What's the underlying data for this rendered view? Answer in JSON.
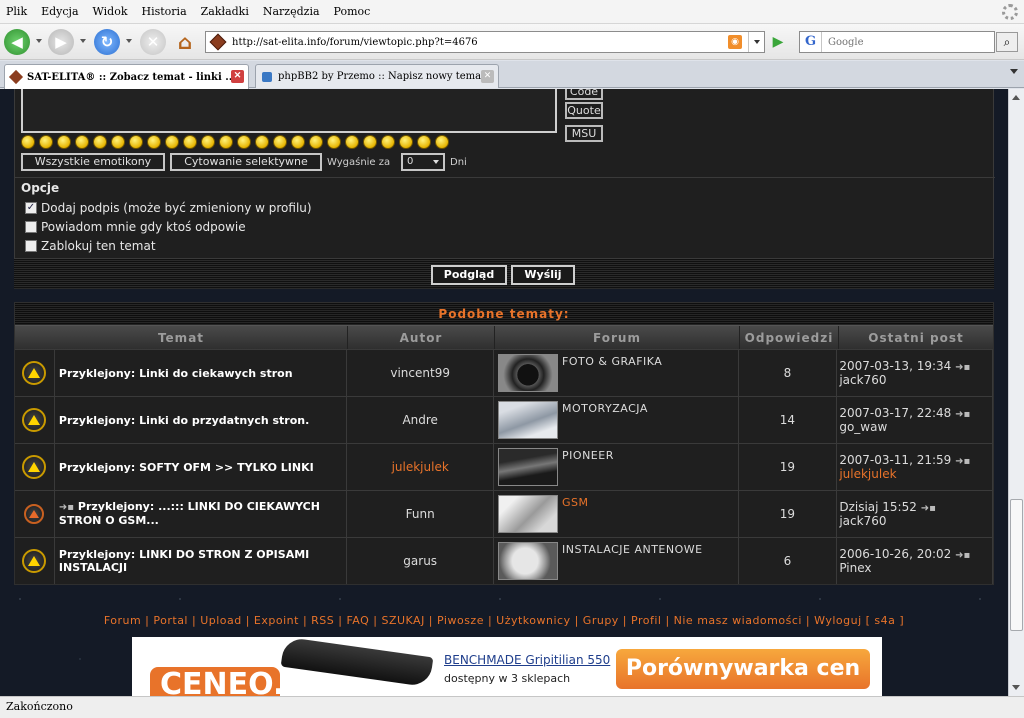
{
  "menu": [
    "Plik",
    "Edycja",
    "Widok",
    "Historia",
    "Zakładki",
    "Narzędzia",
    "Pomoc"
  ],
  "address": {
    "url": "http://sat-elita.info/forum/viewtopic.php?t=4676"
  },
  "search": {
    "engine": "G",
    "placeholder": "Google"
  },
  "tabs": [
    {
      "label": "SAT-ELITA® :: Zobacz temat - linki ..."
    },
    {
      "label": "phpBB2 by Przemo :: Napisz nowy temat"
    }
  ],
  "editor": {
    "side_buttons": [
      "Code",
      "Quote",
      "MSU"
    ],
    "btn_emoticons": "Wszystkie emotikony",
    "btn_quote": "Cytowanie selektywne",
    "expire_label": "Wygaśnie za",
    "expire_value": "0",
    "days": "Dni"
  },
  "options": {
    "title": "Opcje",
    "items": [
      {
        "label": "Dodaj podpis (może być zmieniony w profilu)",
        "checked": true
      },
      {
        "label": "Powiadom mnie gdy ktoś odpowie",
        "checked": false
      },
      {
        "label": "Zablokuj ten temat",
        "checked": false
      }
    ]
  },
  "actions": {
    "preview": "Podgląd",
    "send": "Wyślij"
  },
  "similar": {
    "title": "Podobne tematy:",
    "headers": [
      "Temat",
      "Autor",
      "Forum",
      "Odpowiedzi",
      "Ostatni post"
    ],
    "rows": [
      {
        "prefix": "Przyklejony:",
        "topic": "Linki do ciekawych stron",
        "author": "vincent99",
        "forum": "FOTO & GRAFIKA",
        "replies": "8",
        "last_date": "2007-03-13, 19:34",
        "last_user": "jack760"
      },
      {
        "prefix": "Przyklejony:",
        "topic": "Linki do przydatnych stron.",
        "author": "Andre",
        "forum": "MOTORYZACJA",
        "replies": "14",
        "last_date": "2007-03-17, 22:48",
        "last_user": "go_waw"
      },
      {
        "prefix": "Przyklejony:",
        "topic": "SOFTY OFM >> TYLKO LINKI",
        "author": "julekjulek",
        "forum": "PIONEER",
        "replies": "19",
        "last_date": "2007-03-11, 21:59",
        "last_user": "julekjulek"
      },
      {
        "prefix": "Przyklejony:",
        "topic": "...::: LINKI DO CIEKAWYCH STRON O GSM...",
        "author": "Funn",
        "forum": "GSM",
        "replies": "19",
        "last_date": "Dzisiaj 15:52",
        "last_user": "jack760"
      },
      {
        "prefix": "Przyklejony:",
        "topic": "LINKI DO STRON Z OPISAMI INSTALACJI",
        "author": "garus",
        "forum": "INSTALACJE ANTENOWE",
        "replies": "6",
        "last_date": "2006-10-26, 20:02",
        "last_user": "Pinex"
      }
    ]
  },
  "footer": {
    "links": "Forum | Portal | Upload | Expoint | RSS | FAQ | SZUKAJ | Piwosze | Użytkownicy | Grupy | Profil | Nie masz wiadomości | Wyloguj [ s4a ]"
  },
  "banner": {
    "logo": "CENEO.pl",
    "title": "BENCHMADE Gripitilian 550",
    "sub": "dostępny w 3 sklepach",
    "cta": "Porównywarka cen"
  },
  "status": "Zakończono"
}
